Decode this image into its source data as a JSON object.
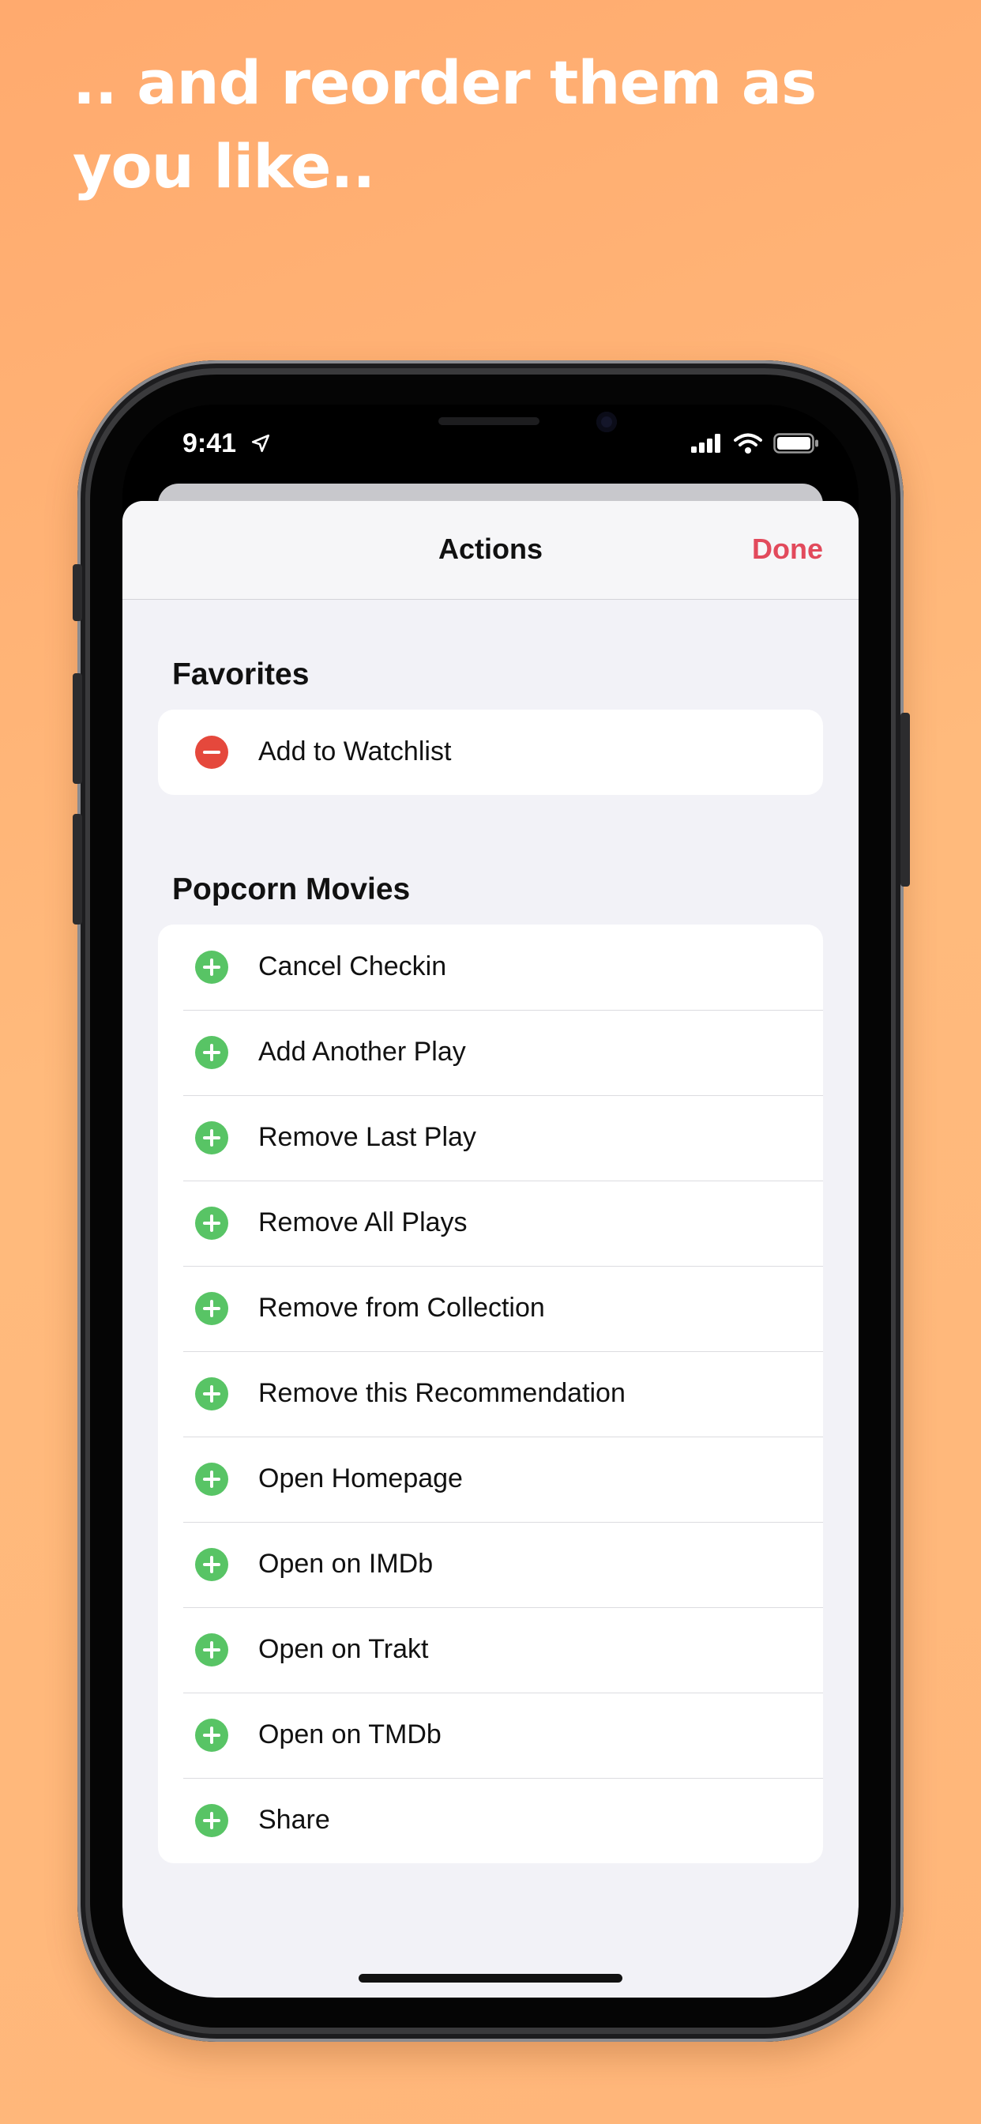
{
  "headline": ".. and reorder them as you like..",
  "status_bar": {
    "time": "9:41",
    "location_icon": "location-arrow-icon",
    "signal_icon": "cellular-signal-icon",
    "wifi_icon": "wifi-icon",
    "battery_icon": "battery-icon"
  },
  "nav": {
    "title": "Actions",
    "done_label": "Done",
    "accent_color": "#e24a5c"
  },
  "sections": [
    {
      "header": "Favorites",
      "items": [
        {
          "label": "Add to Watchlist",
          "control": "remove"
        }
      ]
    },
    {
      "header": "Popcorn Movies",
      "items": [
        {
          "label": "Cancel Checkin",
          "control": "add"
        },
        {
          "label": "Add Another Play",
          "control": "add"
        },
        {
          "label": "Remove Last Play",
          "control": "add"
        },
        {
          "label": "Remove All Plays",
          "control": "add"
        },
        {
          "label": "Remove from Collection",
          "control": "add"
        },
        {
          "label": "Remove this Recommendation",
          "control": "add"
        },
        {
          "label": "Open Homepage",
          "control": "add"
        },
        {
          "label": "Open on IMDb",
          "control": "add"
        },
        {
          "label": "Open on Trakt",
          "control": "add"
        },
        {
          "label": "Open on TMDb",
          "control": "add"
        },
        {
          "label": "Share",
          "control": "add"
        }
      ]
    }
  ],
  "colors": {
    "background": "#ffb277",
    "add_control": "#58c465",
    "remove_control": "#e5483c"
  }
}
